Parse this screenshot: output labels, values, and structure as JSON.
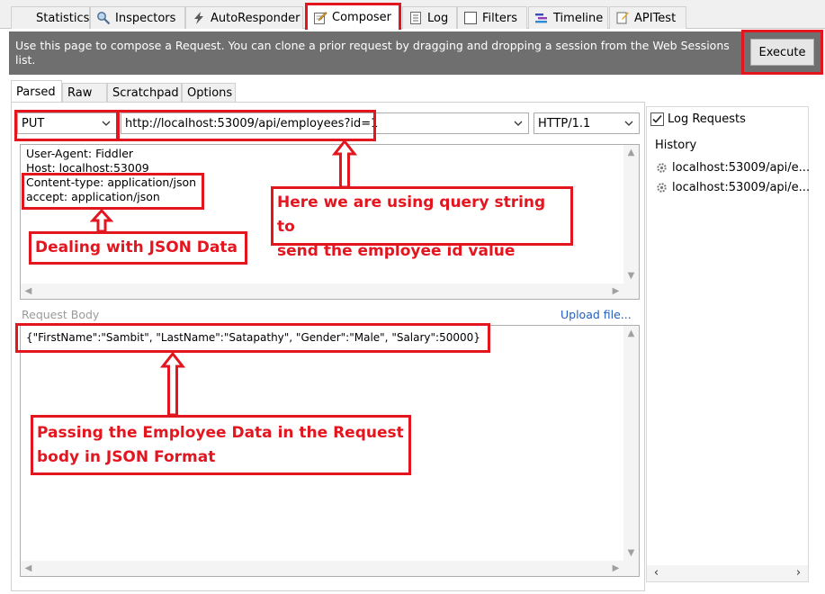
{
  "tabs": [
    {
      "label": "Statistics",
      "icon": "statistics-icon"
    },
    {
      "label": "Inspectors",
      "icon": "inspectors-icon"
    },
    {
      "label": "AutoResponder",
      "icon": "lightning-icon"
    },
    {
      "label": "Composer",
      "icon": "composer-icon",
      "active": true
    },
    {
      "label": "Log",
      "icon": "log-icon"
    },
    {
      "label": "Filters",
      "icon": "checkbox-icon"
    },
    {
      "label": "Timeline",
      "icon": "timeline-icon"
    },
    {
      "label": "APITest",
      "icon": "apitest-icon"
    }
  ],
  "info": {
    "text": "Use this page to compose a Request. You can clone a prior request by dragging and dropping a session from the Web Sessions list.",
    "execute_label": "Execute"
  },
  "subtabs": [
    {
      "label": "Parsed",
      "active": true
    },
    {
      "label": "Raw"
    },
    {
      "label": "Scratchpad"
    },
    {
      "label": "Options"
    }
  ],
  "request": {
    "method": "PUT",
    "url": "http://localhost:53009/api/employees?id=1",
    "http_version": "HTTP/1.1"
  },
  "headers": [
    "User-Agent: Fiddler",
    "Host: localhost:53009",
    "Content-type: application/json",
    "accept: application/json"
  ],
  "body": {
    "label": "Request Body",
    "upload_label": "Upload file...",
    "content": "{\"FirstName\":\"Sambit\", \"LastName\":\"Satapathy\", \"Gender\":\"Male\", \"Salary\":50000}"
  },
  "sidebar": {
    "log_requests_label": "Log Requests",
    "log_requests_checked": true,
    "history_label": "History",
    "history_items": [
      "localhost:53009/api/e...",
      "localhost:53009/api/e..."
    ]
  },
  "annotations": {
    "json_callout": "Dealing with JSON Data",
    "query_callout_line1": "Here we are using query string to",
    "query_callout_line2": "send the employee id value",
    "body_callout_line1": "Passing the Employee Data in the Request",
    "body_callout_line2": "body in JSON Format"
  },
  "colors": {
    "annotation_red": "#e3161f",
    "info_bar": "#6f6f6f",
    "link_blue": "#1f5fbf"
  }
}
